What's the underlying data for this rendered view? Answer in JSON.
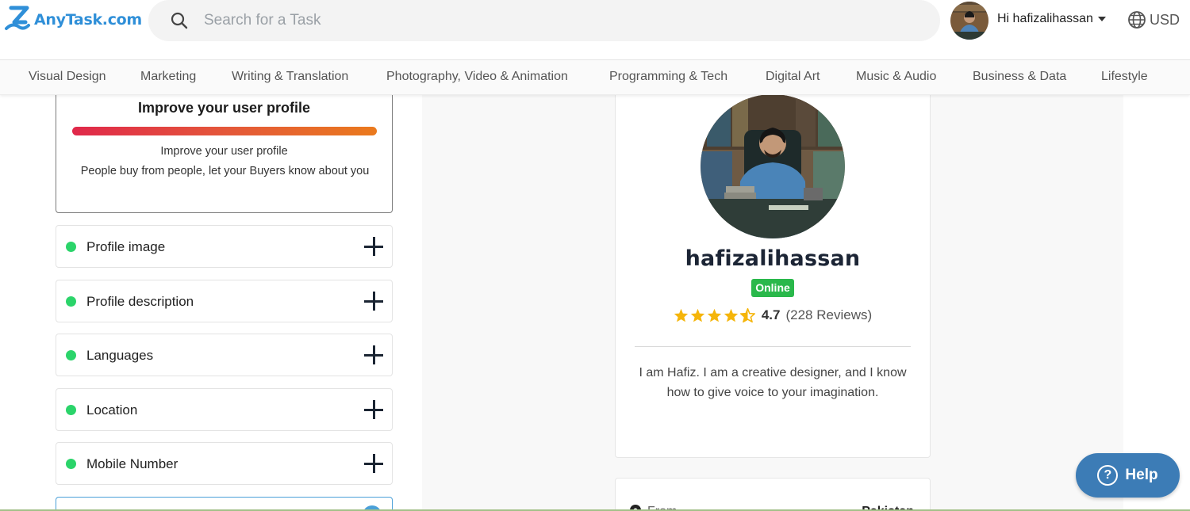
{
  "header": {
    "logo_text": "AnyTask.com",
    "search_placeholder": "Search for a Task",
    "greeting": "Hi hafizalihassan",
    "currency": "USD"
  },
  "categories": [
    "Visual Design",
    "Marketing",
    "Writing & Translation",
    "Photography, Video & Animation",
    "Programming & Tech",
    "Digital Art",
    "Music & Audio",
    "Business & Data",
    "Lifestyle"
  ],
  "improve": {
    "title": "Improve your user profile",
    "subtitle": "Improve your user profile",
    "description": "People buy from people, let your Buyers know about you",
    "progress": 1.0
  },
  "profile_items": [
    {
      "label": "Profile image",
      "status_color": "#2bd46a"
    },
    {
      "label": "Profile description",
      "status_color": "#2bd46a"
    },
    {
      "label": "Languages",
      "status_color": "#2bd46a"
    },
    {
      "label": "Location",
      "status_color": "#2bd46a"
    },
    {
      "label": "Mobile Number",
      "status_color": "#2bd46a"
    }
  ],
  "profile": {
    "username": "hafizalihassan",
    "status": "Online",
    "rating": "4.7",
    "rating_stars": 4.5,
    "reviews": "(228 Reviews)",
    "bio": "I am Hafiz. I am a creative designer, and I know how to give voice to your imagination."
  },
  "details": {
    "from_label": "From",
    "from_value": "Pakistan"
  },
  "help": {
    "label": "Help"
  },
  "colors": {
    "brand": "#2f8fd8",
    "online": "#2ab84b",
    "star": "#f5b50a",
    "help": "#3c7cb6",
    "progress_start": "#e0284a",
    "progress_end": "#ea7a1d"
  }
}
